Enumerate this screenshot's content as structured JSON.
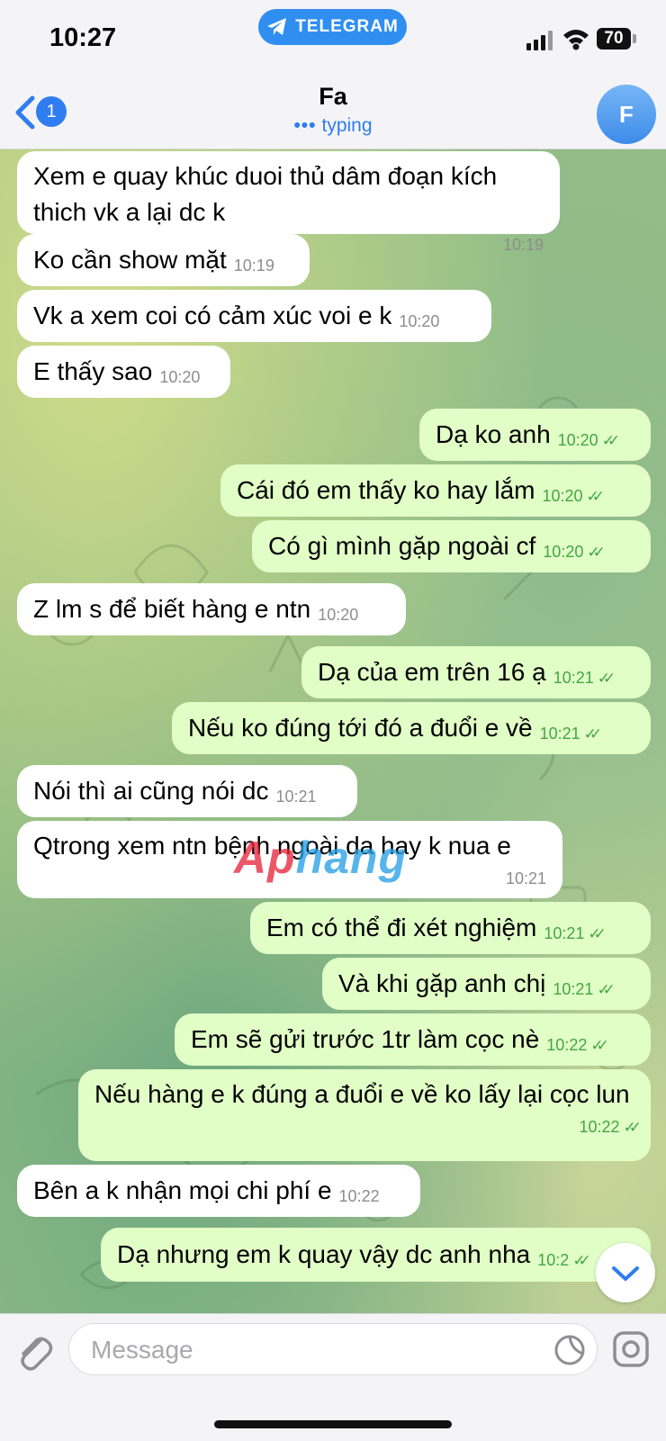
{
  "status_bar": {
    "time": "10:27",
    "app_pill": "TELEGRAM",
    "battery": "70"
  },
  "header": {
    "back_badge": "1",
    "title": "Fa",
    "status": "typing",
    "avatar_letter": "F"
  },
  "messages": [
    {
      "dir": "in",
      "text": "Xem e quay khúc duoi thủ dâm đoạn kích thich vk a lại dc k",
      "time": "10:19"
    },
    {
      "dir": "in",
      "text": "Ko cần show mặt",
      "time": "10:19"
    },
    {
      "dir": "in",
      "text": "Vk a xem coi có cảm xúc voi e k",
      "time": "10:20"
    },
    {
      "dir": "in",
      "text": "E thấy sao",
      "time": "10:20"
    },
    {
      "dir": "out",
      "text": "Dạ ko anh",
      "time": "10:20",
      "read": true
    },
    {
      "dir": "out",
      "text": "Cái đó em thấy ko hay lắm",
      "time": "10:20",
      "read": true
    },
    {
      "dir": "out",
      "text": "Có gì mình gặp ngoài cf",
      "time": "10:20",
      "read": true
    },
    {
      "dir": "in",
      "text": "Z lm s để biết hàng e ntn",
      "time": "10:20"
    },
    {
      "dir": "out",
      "text": "Dạ của em trên 16 ạ",
      "time": "10:21",
      "read": true
    },
    {
      "dir": "out",
      "text": "Nếu ko đúng tới đó a đuổi e về",
      "time": "10:21",
      "read": true
    },
    {
      "dir": "in",
      "text": "Nói thì ai cũng nói dc",
      "time": "10:21"
    },
    {
      "dir": "in",
      "text": "Qtrong xem ntn bệnh ngoài da hay k nua e",
      "time": "10:21"
    },
    {
      "dir": "out",
      "text": "Em có thể đi xét nghiệm",
      "time": "10:21",
      "read": true
    },
    {
      "dir": "out",
      "text": "Và khi gặp anh chị",
      "time": "10:21",
      "read": true
    },
    {
      "dir": "out",
      "text": "Em sẽ gửi trước 1tr làm cọc nè",
      "time": "10:22",
      "read": true
    },
    {
      "dir": "out",
      "text": "Nếu hàng e k đúng a đuổi e về ko lấy lại cọc lun",
      "time": "10:22",
      "read": true
    },
    {
      "dir": "in",
      "text": "Bên a k nhận mọi chi phí e",
      "time": "10:22"
    },
    {
      "dir": "out",
      "text": "Dạ nhưng em k quay vậy dc anh nha",
      "time": "10:2",
      "read": true
    }
  ],
  "watermark": {
    "part1": "Ap",
    "part2": "hang"
  },
  "input": {
    "placeholder": "Message"
  },
  "colors": {
    "accent": "#2f7df0",
    "outgoing_bubble": "#e1fec6",
    "incoming_bubble": "#ffffff",
    "read_ticks": "#45a547"
  }
}
